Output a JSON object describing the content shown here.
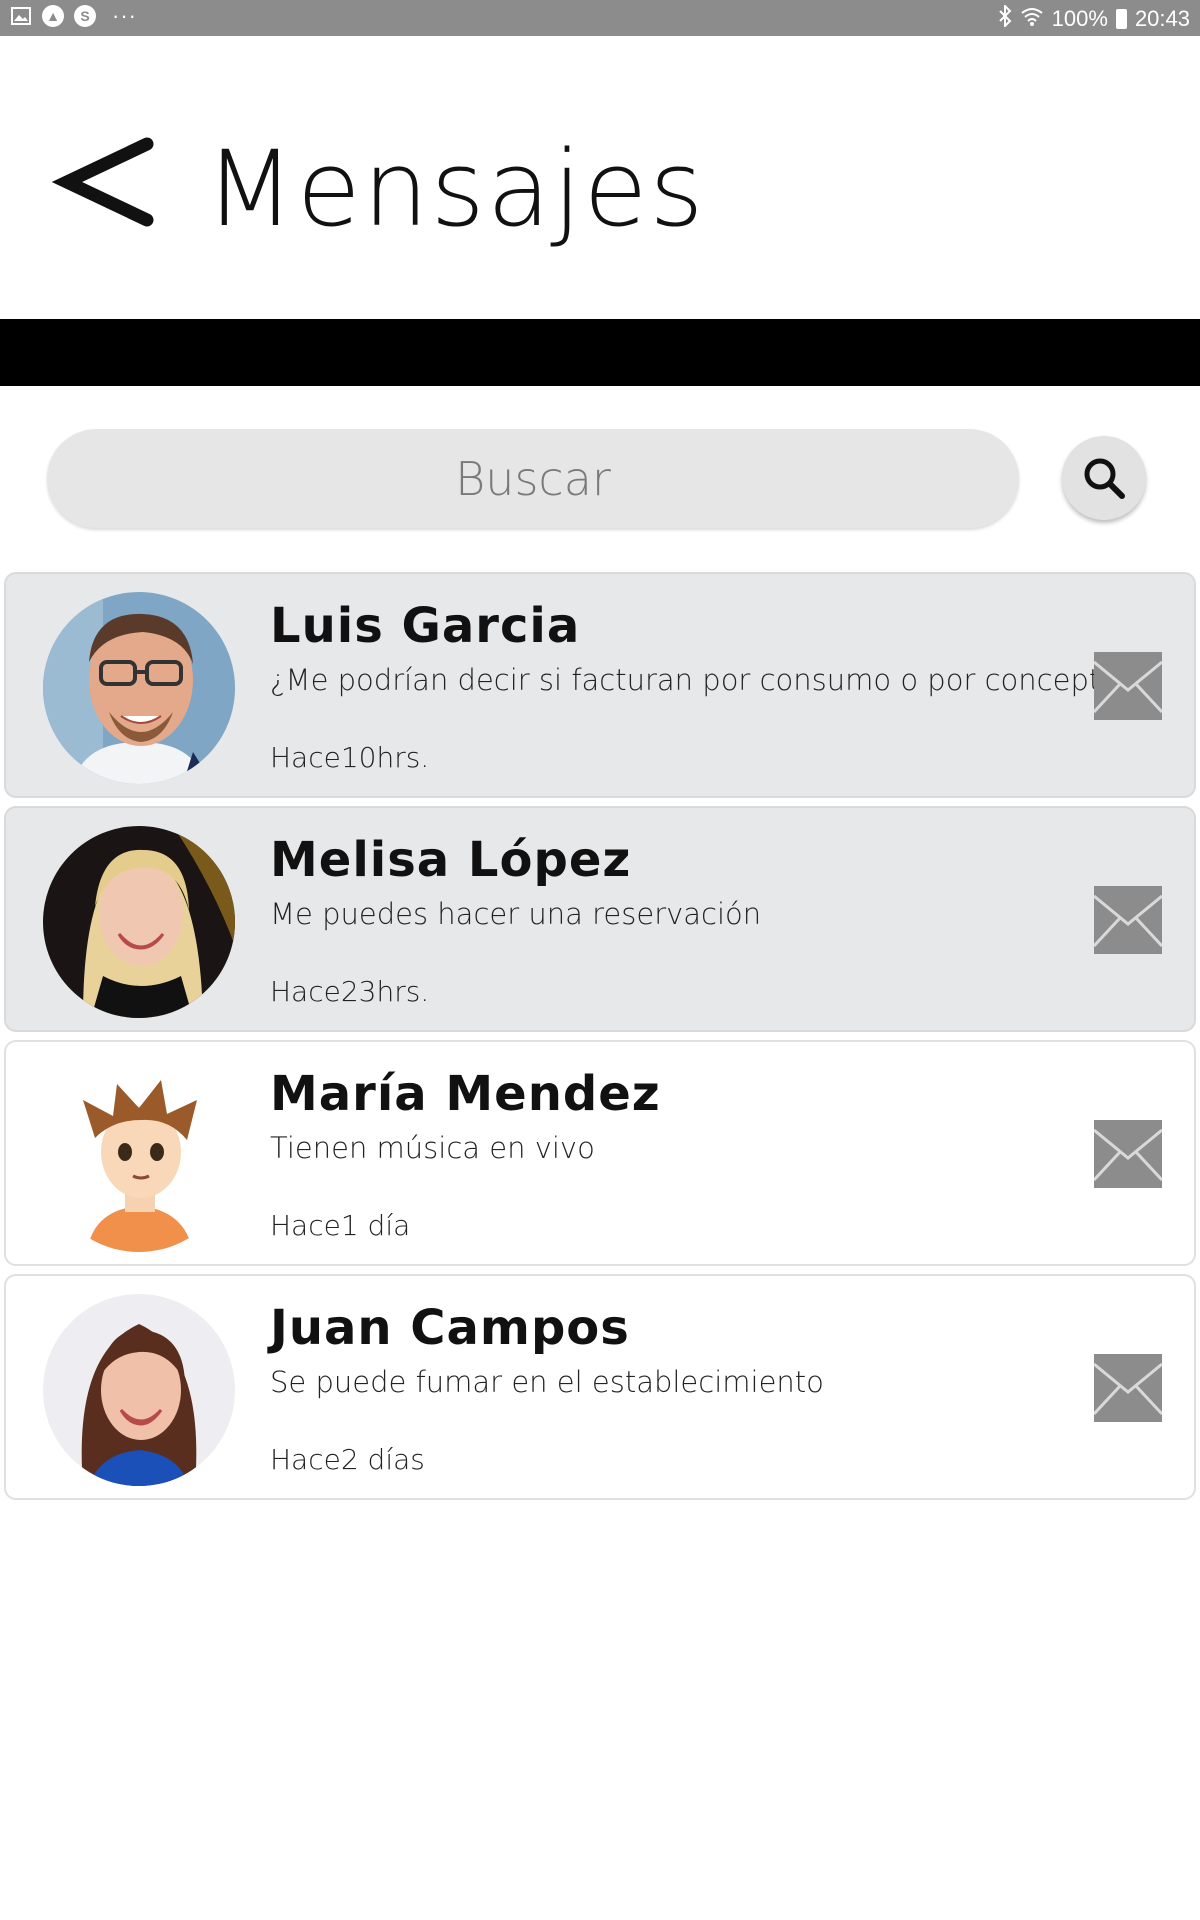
{
  "status_bar": {
    "left_icons": [
      "image-icon",
      "a-circle-icon",
      "s-circle-icon"
    ],
    "dots": "···",
    "battery": "100%",
    "time": "20:43",
    "icons_right": [
      "bluetooth-icon",
      "wifi-icon",
      "battery-icon"
    ]
  },
  "header": {
    "back_icon": "chevron-left-icon",
    "title": "Mensajes"
  },
  "search": {
    "placeholder": "Buscar",
    "button_icon": "search-icon"
  },
  "messages": [
    {
      "name": "Luis Garcia",
      "text": "¿Me podrían decir si facturan por consumo o por concepto?",
      "time": "Hace10hrs.",
      "unread": true,
      "icon": "mail-icon"
    },
    {
      "name": "Melisa López",
      "text": "Me puedes hacer una reservación",
      "time": "Hace23hrs.",
      "unread": true,
      "icon": "mail-icon"
    },
    {
      "name": "María Mendez",
      "text": "Tienen música en vivo",
      "time": "Hace1 día",
      "unread": false,
      "icon": "mail-icon"
    },
    {
      "name": "Juan Campos",
      "text": "Se puede fumar en el establecimiento",
      "time": "Hace2 días",
      "unread": false,
      "icon": "mail-icon"
    }
  ],
  "colors": {
    "status_bar": "#8c8c8c",
    "divider": "#000000",
    "search_bg": "#e6e6e6",
    "unread_bg": "#e7e8ea",
    "mail_icon": "#8a8a8a"
  }
}
